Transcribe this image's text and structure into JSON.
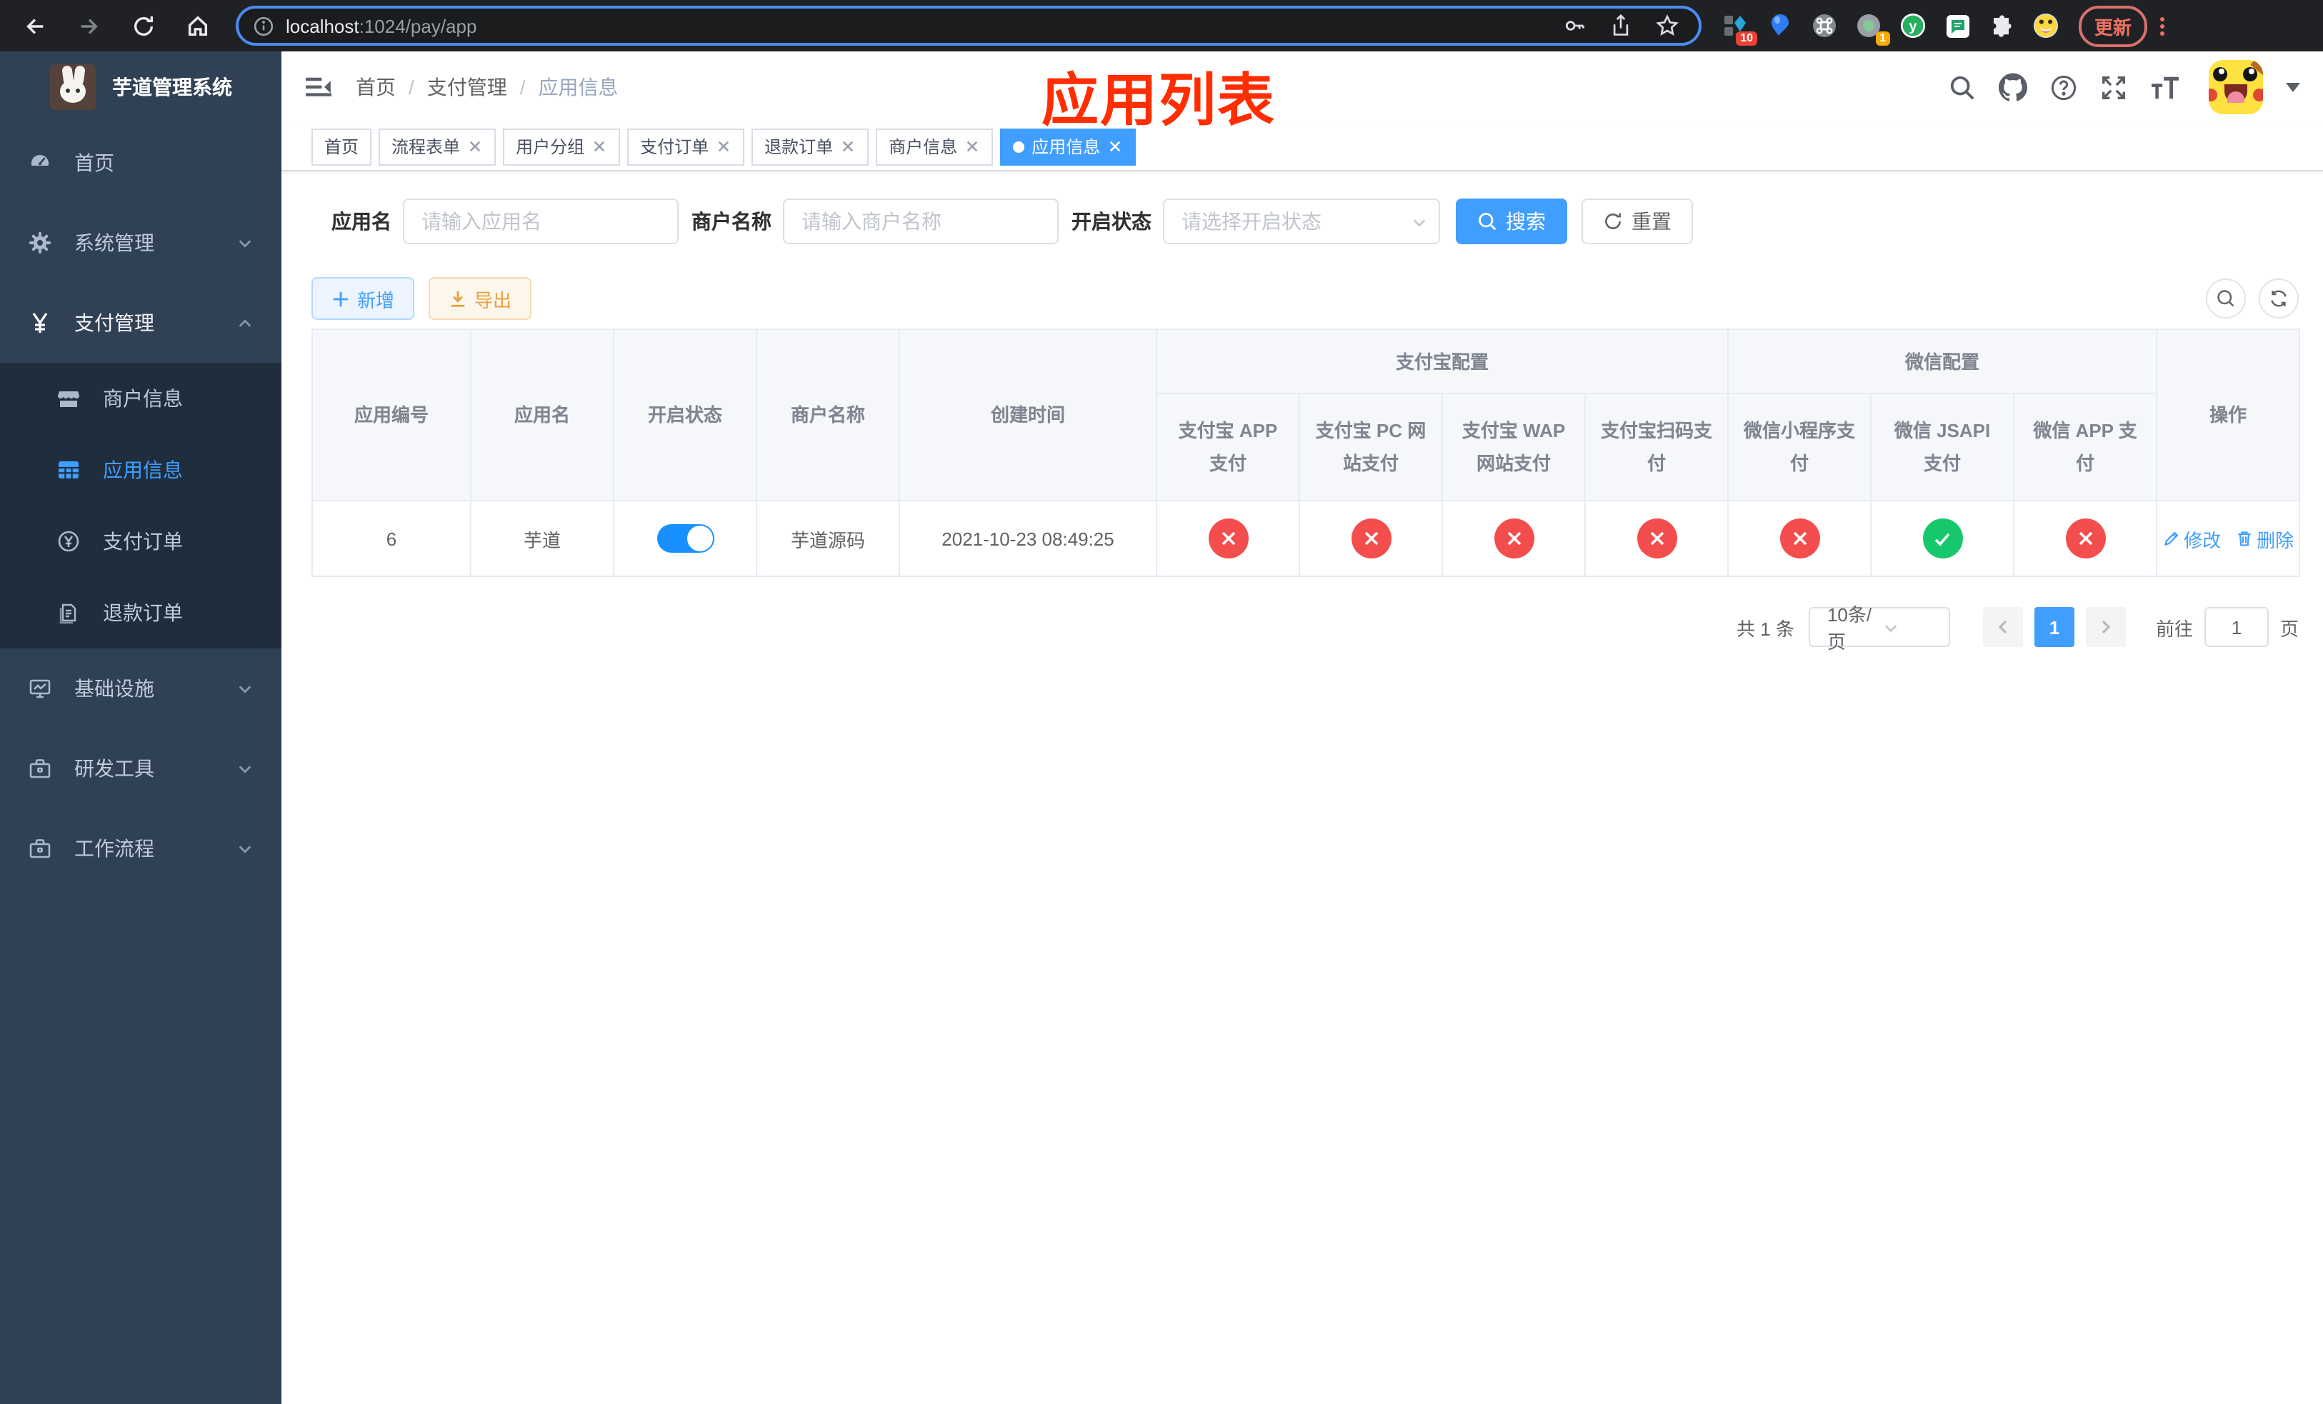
{
  "colors": {
    "accent": "#409eff",
    "sidebar_bg": "#304156",
    "submenu_bg": "#1f2d3d",
    "switch_on": "#1890ff",
    "danger": "#f34d4d",
    "success": "#17c76c",
    "warning": "#e6a23c",
    "annotation_red": "#ff2d00"
  },
  "browser": {
    "url_host": "localhost",
    "url_rest": ":1024/pay/app",
    "ext_badge_blue": "10",
    "ext_badge_gray": "1",
    "update_button": "更新"
  },
  "sidebar": {
    "logo_title": "芋道管理系统",
    "menu": [
      {
        "label": "首页",
        "icon": "dashboard-icon"
      },
      {
        "label": "系统管理",
        "icon": "gear-icon"
      },
      {
        "label": "支付管理",
        "icon": "yen-icon"
      },
      {
        "label": "基础设施",
        "icon": "monitor-icon"
      },
      {
        "label": "研发工具",
        "icon": "toolbox-icon"
      },
      {
        "label": "工作流程",
        "icon": "briefcase-icon"
      }
    ],
    "payment_submenu": [
      {
        "label": "商户信息",
        "icon": "shop-icon"
      },
      {
        "label": "应用信息",
        "icon": "grid-icon"
      },
      {
        "label": "支付订单",
        "icon": "coin-icon"
      },
      {
        "label": "退款订单",
        "icon": "document-icon"
      }
    ]
  },
  "navbar": {
    "breadcrumb": {
      "items": [
        "首页",
        "支付管理",
        "应用信息"
      ],
      "separator": "/"
    },
    "annotation": "应用列表"
  },
  "tabs": [
    {
      "label": "首页"
    },
    {
      "label": "流程表单"
    },
    {
      "label": "用户分组"
    },
    {
      "label": "支付订单"
    },
    {
      "label": "退款订单"
    },
    {
      "label": "商户信息"
    },
    {
      "label": "应用信息"
    }
  ],
  "filters": {
    "app_name_label": "应用名",
    "app_name_placeholder": "请输入应用名",
    "merchant_label": "商户名称",
    "merchant_placeholder": "请输入商户名称",
    "status_label": "开启状态",
    "status_placeholder": "请选择开启状态",
    "search_button": "搜索",
    "reset_button": "重置"
  },
  "toolbar": {
    "add_button": "新增",
    "export_button": "导出"
  },
  "table": {
    "headers": {
      "app_id": "应用编号",
      "app_name": "应用名",
      "open_status": "开启状态",
      "merchant_name": "商户名称",
      "create_time": "创建时间",
      "alipay_group": "支付宝配置",
      "alipay_cols": [
        "支付宝 APP 支付",
        "支付宝 PC 网站支付",
        "支付宝 WAP 网站支付",
        "支付宝扫码支付"
      ],
      "wechat_group": "微信配置",
      "wechat_cols": [
        "微信小程序支付",
        "微信 JSAPI 支付",
        "微信 APP 支付"
      ],
      "actions": "操作"
    },
    "rows": [
      {
        "app_id": "6",
        "app_name": "芋道",
        "enabled": true,
        "merchant_name": "芋道源码",
        "create_time": "2021-10-23 08:49:25",
        "statuses": [
          "no",
          "no",
          "no",
          "no",
          "no",
          "yes",
          "no"
        ],
        "edit_label": "修改",
        "delete_label": "删除"
      }
    ]
  },
  "pagination": {
    "total_text": "共 1 条",
    "page_size_text": "10条/页",
    "current_page": "1",
    "goto_label": "前往",
    "goto_value": "1",
    "page_unit": "页"
  }
}
